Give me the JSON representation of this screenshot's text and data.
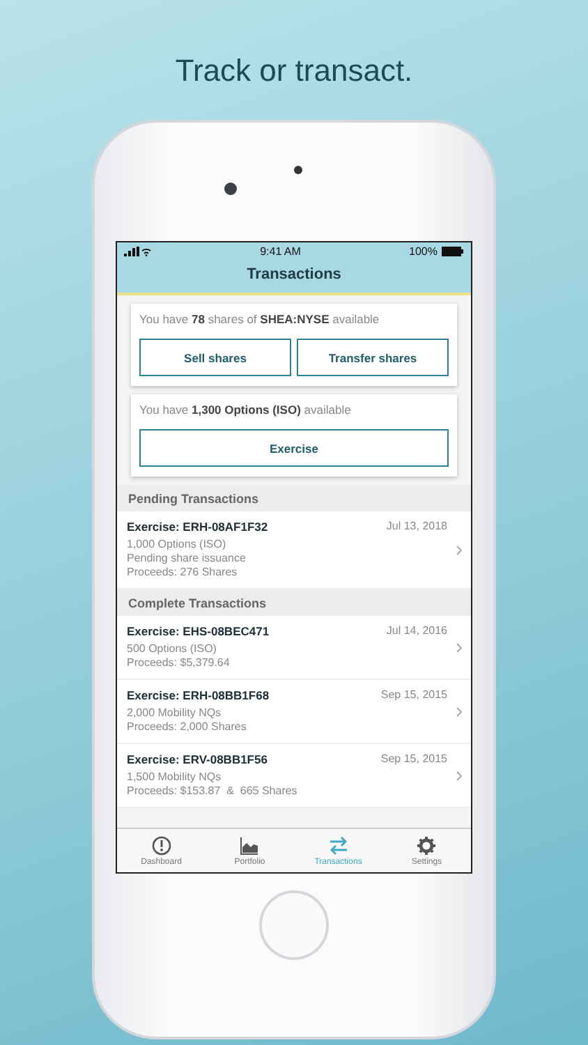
{
  "headline": "Track or transact.",
  "status_bar": {
    "time": "9:41 AM",
    "battery": "100%"
  },
  "nav": {
    "title": "Transactions"
  },
  "cards": [
    {
      "text": "You have **78** shares of **SHEA:NYSE** available",
      "buttons": [
        "Sell shares",
        "Transfer shares"
      ]
    },
    {
      "text": "You have **1,300 Options (ISO)** available",
      "buttons": [
        "Exercise"
      ]
    }
  ],
  "sections": [
    {
      "title": "Pending Transactions",
      "rows": [
        {
          "title": "Exercise: ERH-08AF1F32",
          "date": "Jul 13, 2018",
          "lines": [
            "1,000 Options (ISO)",
            "Pending share issuance",
            "Proceeds: 276 Shares"
          ]
        }
      ]
    },
    {
      "title": "Complete Transactions",
      "rows": [
        {
          "title": "Exercise: EHS-08BEC471",
          "date": "Jul 14, 2016",
          "lines": [
            "500 Options (ISO)",
            "Proceeds: $5,379.64"
          ]
        },
        {
          "title": "Exercise: ERH-08BB1F68",
          "date": "Sep 15, 2015",
          "lines": [
            "2,000 Mobility NQs",
            "Proceeds: 2,000 Shares"
          ]
        },
        {
          "title": "Exercise: ERV-08BB1F56",
          "date": "Sep 15, 2015",
          "lines": [
            "1,500 Mobility NQs",
            "Proceeds: $153.87  &  665 Shares"
          ]
        }
      ]
    }
  ],
  "tabs": [
    {
      "label": "Dashboard",
      "selected": false
    },
    {
      "label": "Portfolio",
      "selected": false
    },
    {
      "label": "Transactions",
      "selected": true
    },
    {
      "label": "Settings",
      "selected": false
    }
  ]
}
